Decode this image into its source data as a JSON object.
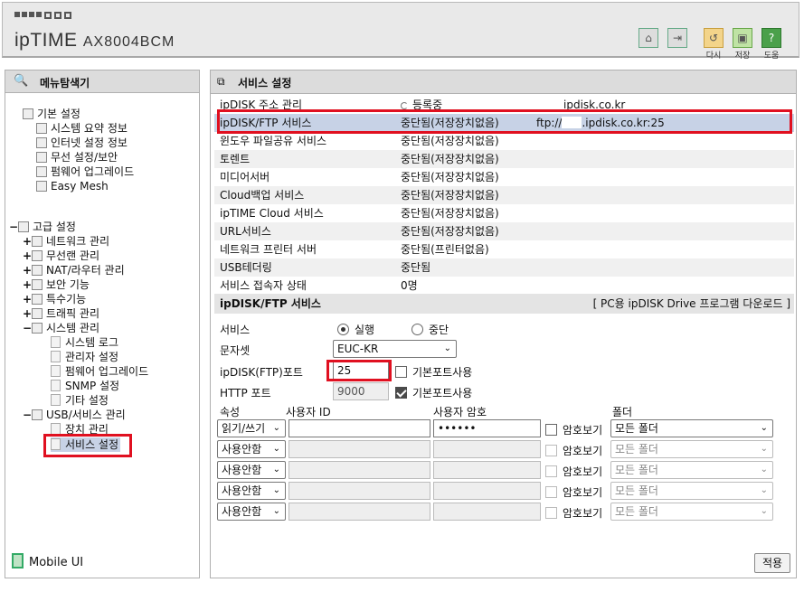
{
  "header": {
    "brand": "ipTIME",
    "model": "AX8004BCM",
    "buttons": [
      {
        "label": "",
        "icon": "home-icon"
      },
      {
        "label": "",
        "icon": "logout-icon"
      },
      {
        "label": "다시",
        "icon": "refresh-icon"
      },
      {
        "label": "저장",
        "icon": "save-icon"
      },
      {
        "label": "도움",
        "icon": "help-icon"
      }
    ]
  },
  "sidebar": {
    "title": "메뉴탐색기",
    "basic": {
      "title": "기본 설정",
      "items": [
        "시스템 요약 정보",
        "인터넷 설정 정보",
        "무선 설정/보안",
        "펌웨어 업그레이드",
        "Easy Mesh"
      ]
    },
    "advanced": {
      "title": "고급 설정",
      "items": [
        "네트워크 관리",
        "무선랜 관리",
        "NAT/라우터 관리",
        "보안 기능",
        "특수기능",
        "트래픽 관리",
        "시스템 관리"
      ],
      "system_children": [
        "시스템 로그",
        "관리자 설정",
        "펌웨어 업그레이드",
        "SNMP 설정",
        "기타 설정"
      ],
      "usb": "USB/서비스 관리",
      "usb_children": [
        "장치 관리",
        "서비스 설정"
      ]
    },
    "mobile_ui": "Mobile UI"
  },
  "main": {
    "title": "서비스 설정",
    "services": [
      {
        "name": "ipDISK 주소 관리",
        "status": "등록중",
        "extra": "ipdisk.co.kr"
      },
      {
        "name": "ipDISK/FTP 서비스",
        "status": "중단됨(저장장치없음)",
        "extra_prefix": "ftp://",
        "extra": ".ipdisk.co.kr:25"
      },
      {
        "name": "윈도우 파일공유 서비스",
        "status": "중단됨(저장장치없음)"
      },
      {
        "name": "토렌트",
        "status": "중단됨(저장장치없음)"
      },
      {
        "name": "미디어서버",
        "status": "중단됨(저장장치없음)"
      },
      {
        "name": "Cloud백업 서비스",
        "status": "중단됨(저장장치없음)"
      },
      {
        "name": "ipTIME Cloud 서비스",
        "status": "중단됨(저장장치없음)"
      },
      {
        "name": "URL서비스",
        "status": "중단됨(저장장치없음)"
      },
      {
        "name": "네트워크 프린터 서버",
        "status": "중단됨(프린터없음)"
      },
      {
        "name": "USB테더링",
        "status": "중단됨"
      },
      {
        "name": "서비스 접속자 상태",
        "status": "0명"
      }
    ],
    "ftp": {
      "section_title": "ipDISK/FTP 서비스",
      "download_link": "[ PC용 ipDISK Drive 프로그램 다운로드 ]",
      "service_label": "서비스",
      "run_label": "실행",
      "stop_label": "중단",
      "charset_label": "문자셋",
      "charset_value": "EUC-KR",
      "ftp_port_label": "ipDISK(FTP)포트",
      "ftp_port_value": "25",
      "default_port_label": "기본포트사용",
      "http_port_label": "HTTP 포트",
      "http_port_value": "9000",
      "col_attr": "속성",
      "col_user": "사용자 ID",
      "col_pass": "사용자 암호",
      "col_folder": "폴더",
      "show_pass": "암호보기",
      "accounts": [
        {
          "attr": "읽기/쓰기",
          "user": "",
          "pass": "••••••",
          "folder": "모든 폴더",
          "enabled": true
        },
        {
          "attr": "사용안함",
          "user": "",
          "pass": "",
          "folder": "모든 폴더",
          "enabled": false
        },
        {
          "attr": "사용안함",
          "user": "",
          "pass": "",
          "folder": "모든 폴더",
          "enabled": false
        },
        {
          "attr": "사용안함",
          "user": "",
          "pass": "",
          "folder": "모든 폴더",
          "enabled": false
        },
        {
          "attr": "사용안함",
          "user": "",
          "pass": "",
          "folder": "모든 폴더",
          "enabled": false
        }
      ],
      "apply": "적용"
    }
  },
  "colors": {
    "highlight": "#e01020",
    "selected_row": "#c7d2e6",
    "panel_bar": "#dcdcdc"
  }
}
